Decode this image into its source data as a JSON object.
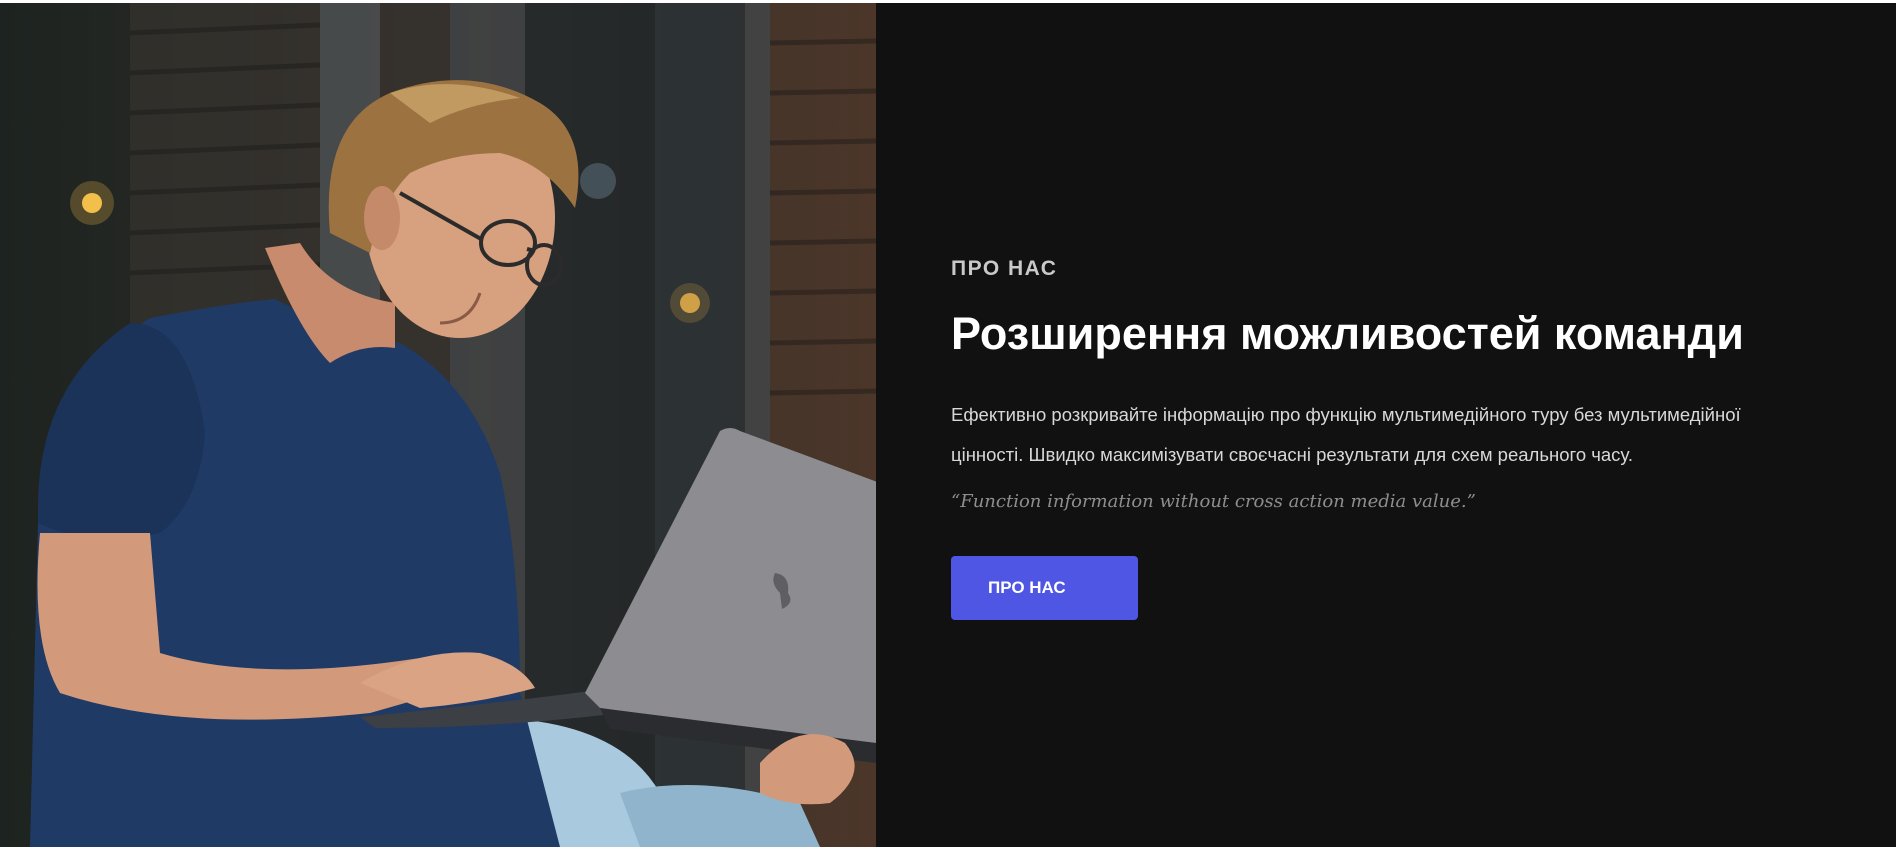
{
  "hero_image": {
    "alt": "",
    "subject": "person-with-laptop-photo"
  },
  "about": {
    "eyebrow": "ПРО НАС",
    "heading": "Розширення можливостей команди",
    "body_line_1": "Ефективно розкривайте інформацію про функцію мультимедійного туру без мультимедійної",
    "body_line_2": "цінності. Швидко максимізувати своєчасні результати для схем реального часу.",
    "quote": "“Function information without cross action media value.”",
    "button_label": "ПРО НАС"
  },
  "colors": {
    "panel_background": "#111111",
    "heading": "#ffffff",
    "body_text": "#d8d8d8",
    "quote_text": "#8e8e8e",
    "button_background": "#4f56e3",
    "button_text": "#ffffff"
  }
}
